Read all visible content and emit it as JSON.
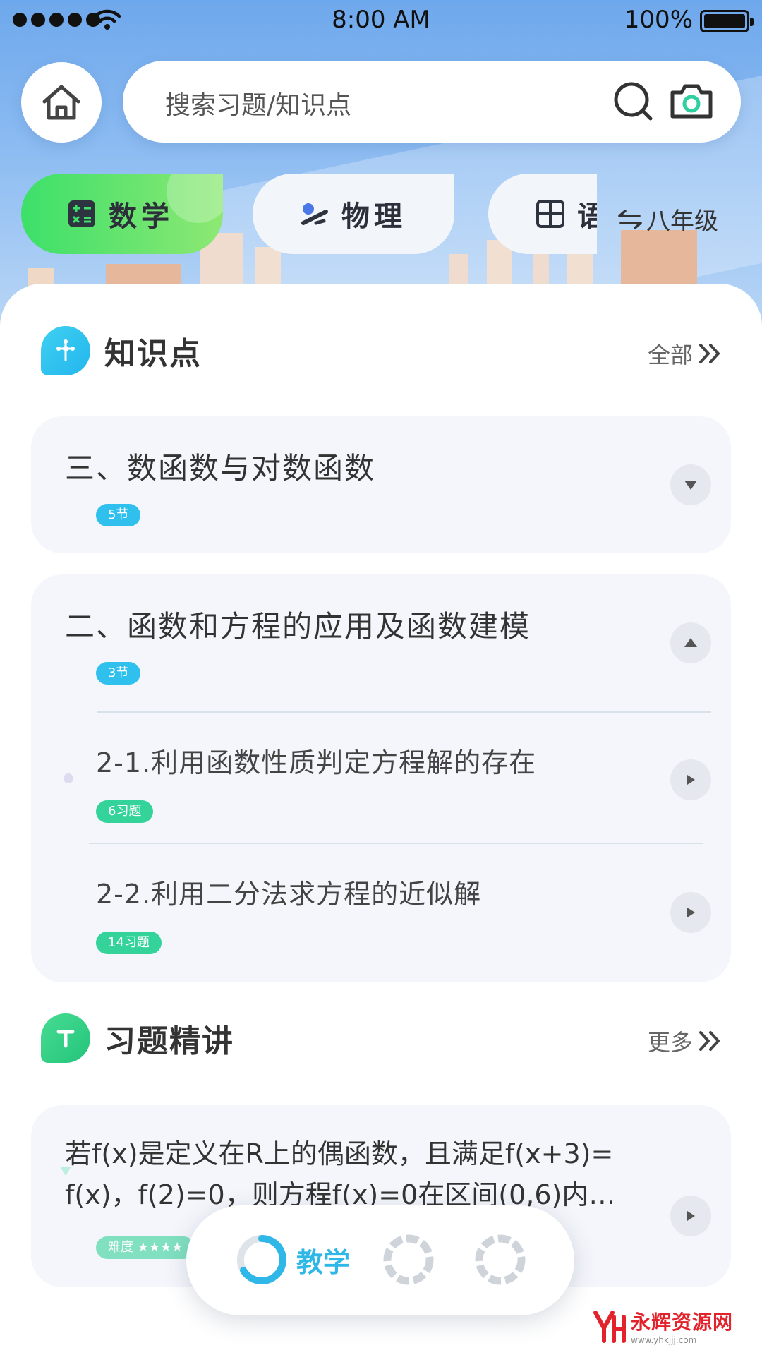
{
  "status_bar": {
    "time": "8:00 AM",
    "battery": "100%"
  },
  "search": {
    "placeholder": "搜索习题/知识点",
    "icons": [
      "home-icon",
      "search-icon",
      "camera-icon"
    ]
  },
  "subjects": {
    "tabs": [
      {
        "label": "数学",
        "icon": "calculator-icon",
        "active": true
      },
      {
        "label": "物理",
        "icon": "physics-icon",
        "active": false
      },
      {
        "label": "语",
        "icon": "grid-icon",
        "active": false
      }
    ],
    "grade_label": "八年级"
  },
  "knowledge": {
    "title": "知识点",
    "more_label": "全部",
    "chapters": [
      {
        "title": "三、数函数与对数函数",
        "badge": "5节",
        "expanded": false
      },
      {
        "title": "二、函数和方程的应用及函数建模",
        "badge": "3节",
        "expanded": true,
        "sections": [
          {
            "title": "2-1.利用函数性质判定方程解的存在",
            "badge": "6习题"
          },
          {
            "title": "2-2.利用二分法求方程的近似解",
            "badge": "14习题"
          }
        ]
      }
    ]
  },
  "exercises": {
    "title": "习题精讲",
    "more_label": "更多",
    "items": [
      {
        "line1": "若f(x)是定义在R上的偶函数，且满足f(x+3)=",
        "line2": "f(x)，f(2)=0，则方程f(x)=0在区间(0,6)内…",
        "difficulty_label": "难度 ★★★★"
      }
    ]
  },
  "bottom_nav": {
    "active_label": "教学"
  },
  "watermark": {
    "name": "永辉资源网",
    "url": "www.yhkjjj.com"
  },
  "colors": {
    "accent_blue": "#2fc0ee",
    "accent_green": "#34d39a",
    "math_tab": "#3ce06a"
  }
}
